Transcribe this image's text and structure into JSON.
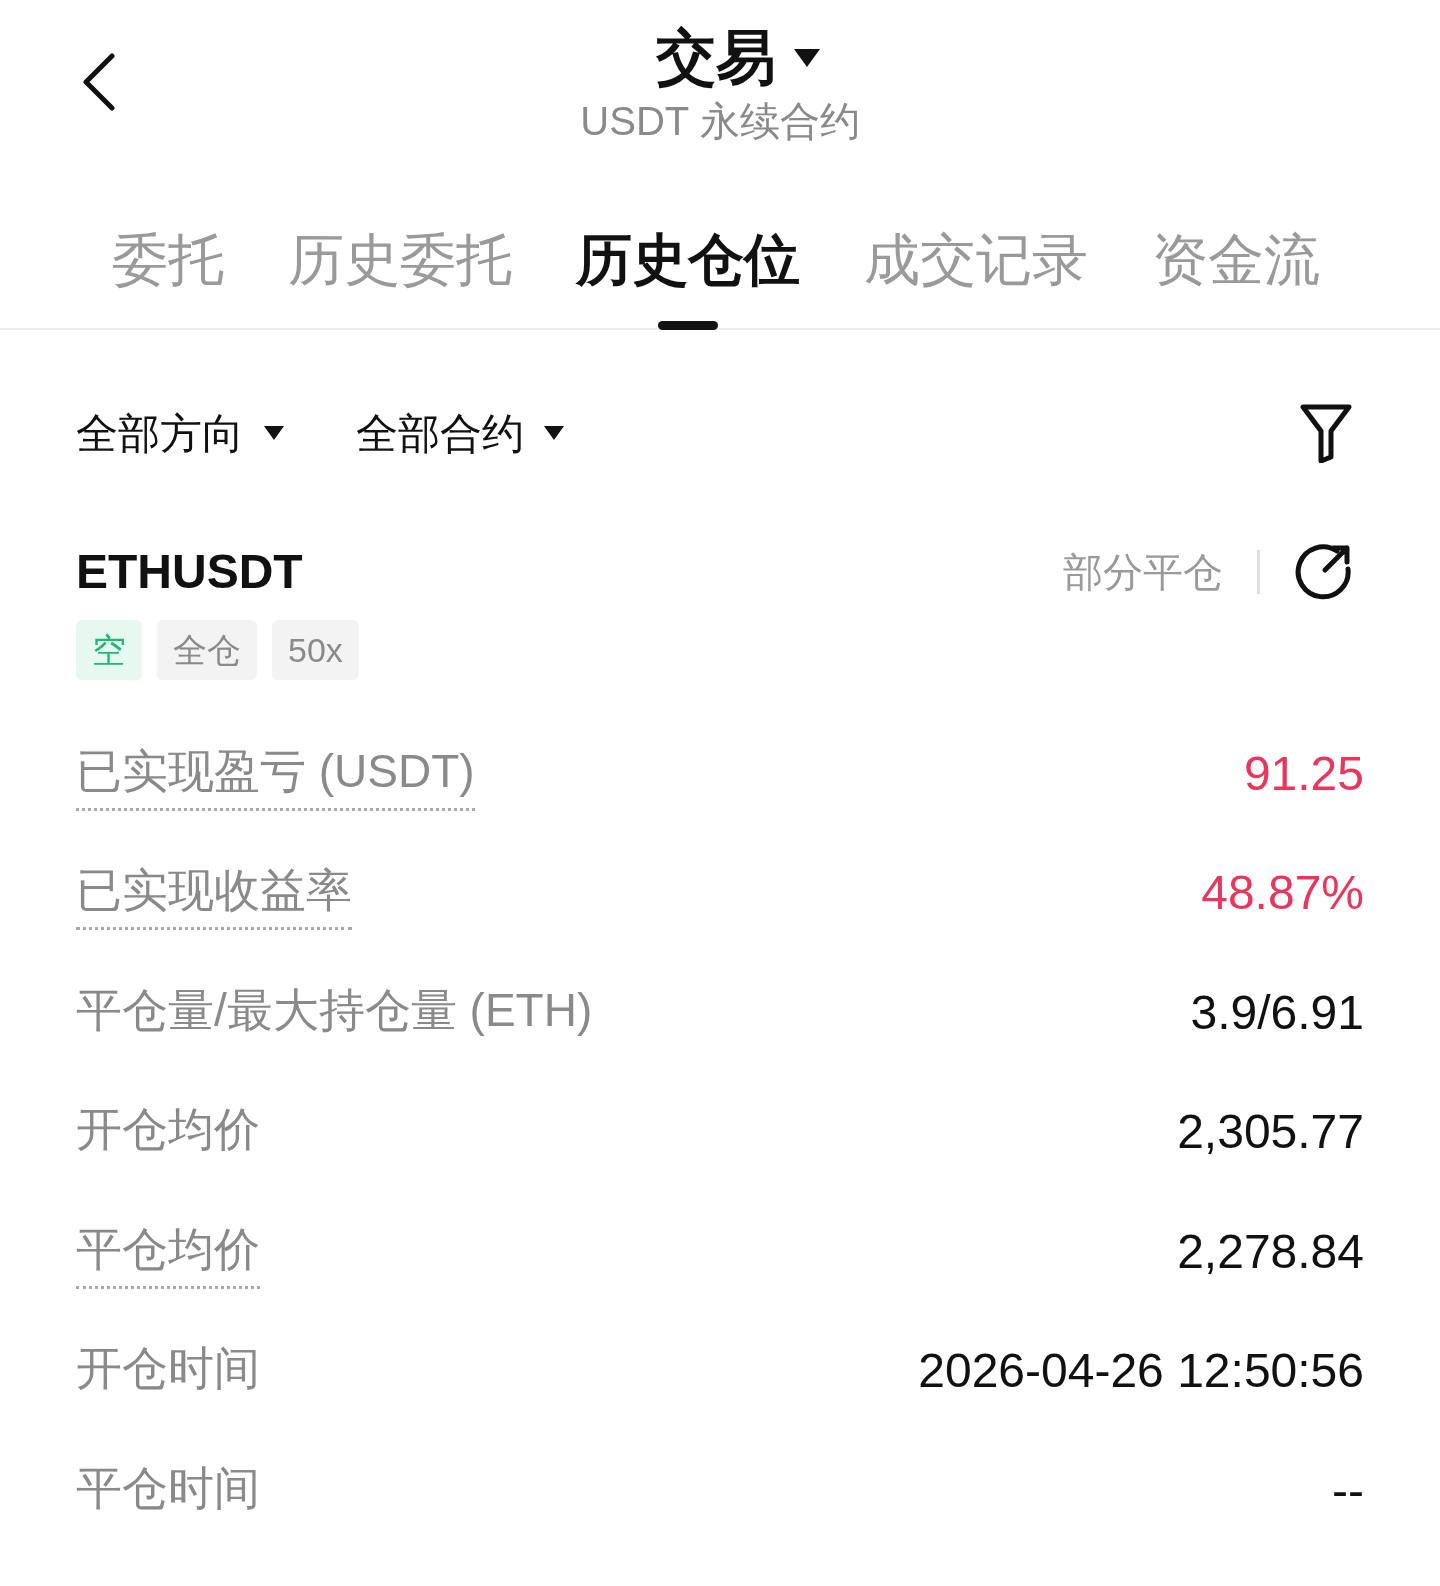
{
  "header": {
    "title": "交易",
    "subtitle": "USDT 永续合约"
  },
  "tabs": [
    {
      "label": "委托",
      "selected": false
    },
    {
      "label": "历史委托",
      "selected": false
    },
    {
      "label": "历史仓位",
      "selected": true
    },
    {
      "label": "成交记录",
      "selected": false
    },
    {
      "label": "资金流",
      "selected": false
    }
  ],
  "filters": [
    {
      "label": "全部方向"
    },
    {
      "label": "全部合约"
    }
  ],
  "position": {
    "symbol": "ETHUSDT",
    "status": "部分平仓",
    "tags": [
      {
        "label": "空",
        "kind": "side"
      },
      {
        "label": "全仓",
        "kind": "plain"
      },
      {
        "label": "50x",
        "kind": "plain"
      }
    ],
    "rows": [
      {
        "label": "已实现盈亏 (USDT)",
        "value": "91.25",
        "dotted": true,
        "color": "#e8365d"
      },
      {
        "label": "已实现收益率",
        "value": "48.87%",
        "dotted": true,
        "color": "#e8365d"
      },
      {
        "label": "平仓量/最大持仓量 (ETH)",
        "value": "3.9/6.91",
        "dotted": false,
        "color": "#111111"
      },
      {
        "label": "开仓均价",
        "value": "2,305.77",
        "dotted": false,
        "color": "#111111"
      },
      {
        "label": "平仓均价",
        "value": "2,278.84",
        "dotted": true,
        "color": "#111111"
      },
      {
        "label": "开仓时间",
        "value": "2026-04-26 12:50:56",
        "dotted": false,
        "color": "#111111"
      },
      {
        "label": "平仓时间",
        "value": "--",
        "dotted": false,
        "color": "#111111"
      }
    ]
  }
}
